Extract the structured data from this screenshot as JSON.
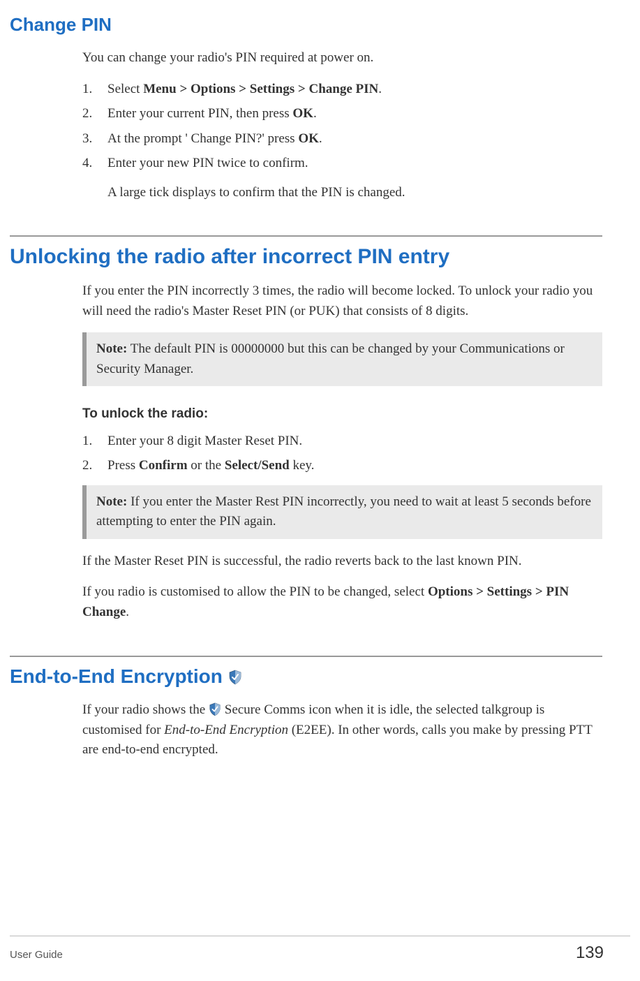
{
  "section1": {
    "heading": "Change PIN",
    "intro": "You can change your radio's PIN required at power on.",
    "steps": [
      {
        "marker": "1.",
        "parts": [
          {
            "t": "Select "
          },
          {
            "t": "Menu > Options > Settings > Change PIN",
            "bold": true
          },
          {
            "t": "."
          }
        ]
      },
      {
        "marker": "2.",
        "parts": [
          {
            "t": "Enter your current PIN, then press "
          },
          {
            "t": "OK",
            "bold": true
          },
          {
            "t": "."
          }
        ]
      },
      {
        "marker": "3.",
        "parts": [
          {
            "t": "At the prompt ' Change PIN?' press "
          },
          {
            "t": "OK",
            "bold": true
          },
          {
            "t": "."
          }
        ]
      },
      {
        "marker": "4.",
        "parts": [
          {
            "t": "Enter your new PIN twice to confirm."
          }
        ],
        "sub": "A large tick displays to confirm that the PIN is changed."
      }
    ]
  },
  "section2": {
    "heading": "Unlocking the radio after incorrect PIN entry",
    "intro": "If you enter the PIN incorrectly 3 times, the radio will become locked. To unlock your radio you will need the radio's Master Reset PIN (or PUK) that consists of 8 digits.",
    "note1_label": "Note:",
    "note1_text": "  The default PIN is 00000000 but this can be changed by your Communications or Security Manager.",
    "sub_heading": "To unlock the radio:",
    "steps": [
      {
        "marker": "1.",
        "parts": [
          {
            "t": "Enter your 8 digit Master Reset PIN."
          }
        ]
      },
      {
        "marker": "2.",
        "parts": [
          {
            "t": "Press "
          },
          {
            "t": "Confirm",
            "bold": true
          },
          {
            "t": " or the "
          },
          {
            "t": "Select/Send",
            "bold": true
          },
          {
            "t": " key."
          }
        ]
      }
    ],
    "note2_label": "Note:",
    "note2_text": "  If you enter the Master Rest PIN incorrectly, you need to wait at least 5 seconds before attempting to enter the PIN again.",
    "para2": "If the Master Reset PIN is successful, the radio reverts back to the last known PIN.",
    "para3_parts": [
      {
        "t": "If you radio is customised to allow the PIN to be changed, select "
      },
      {
        "t": "Options > Settings > PIN Change",
        "bold": true
      },
      {
        "t": "."
      }
    ]
  },
  "section3": {
    "heading": "End-to-End Encryption ",
    "para_parts": [
      {
        "t": "If your radio shows the "
      },
      {
        "icon": "shield"
      },
      {
        "t": " Secure Comms icon when it is idle, the selected talkgroup is customised for "
      },
      {
        "t": "End-to-End Encryption",
        "italic": true
      },
      {
        "t": " (E2EE). In other words, calls you make by pressing PTT are end-to-end encrypted."
      }
    ]
  },
  "footer": {
    "guide_label": "User Guide",
    "page_number": "139"
  }
}
